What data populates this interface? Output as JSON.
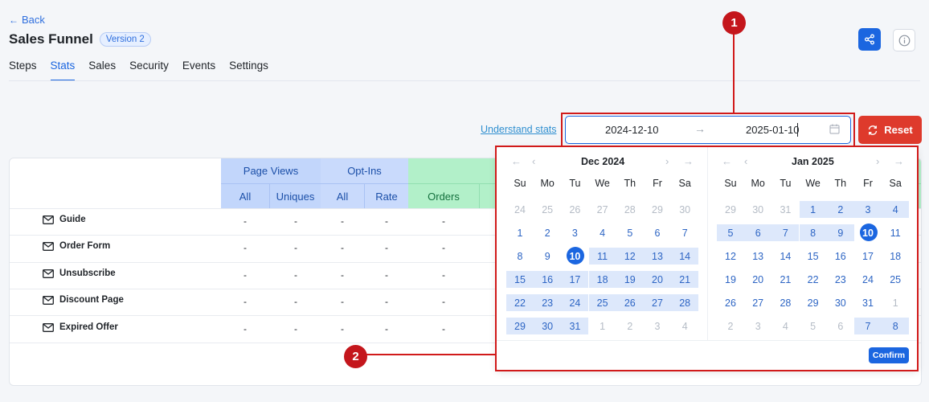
{
  "nav": {
    "back_label": "Back"
  },
  "header": {
    "title": "Sales Funnel",
    "version_badge": "Version 2"
  },
  "tabs": [
    {
      "label": "Steps",
      "active": false
    },
    {
      "label": "Stats",
      "active": true
    },
    {
      "label": "Sales",
      "active": false
    },
    {
      "label": "Security",
      "active": false
    },
    {
      "label": "Events",
      "active": false
    },
    {
      "label": "Settings",
      "active": false
    }
  ],
  "toolbar": {
    "understand_stats_link": "Understand stats",
    "start_date": "2024-12-10",
    "end_date": "2025-01-10",
    "reset_label": "Reset",
    "accent_color": "#1b66e0",
    "reset_color": "#de3a2c"
  },
  "annotations": {
    "marker1": "1",
    "marker2": "2"
  },
  "table": {
    "groups": [
      "Page Views",
      "Opt-Ins"
    ],
    "subcolumns": [
      "All",
      "Uniques",
      "All",
      "Rate",
      "Orders"
    ],
    "rows": [
      {
        "label": "Guide",
        "cells": [
          "-",
          "-",
          "-",
          "-",
          "-"
        ]
      },
      {
        "label": "Order Form",
        "cells": [
          "-",
          "-",
          "-",
          "-",
          "-"
        ]
      },
      {
        "label": "Unsubscribe",
        "cells": [
          "-",
          "-",
          "-",
          "-",
          "-"
        ]
      },
      {
        "label": "Discount Page",
        "cells": [
          "-",
          "-",
          "-",
          "-",
          "-"
        ]
      },
      {
        "label": "Expired Offer",
        "cells": [
          "-",
          "-",
          "-",
          "-",
          "-"
        ]
      }
    ]
  },
  "datepicker": {
    "weekdays": [
      "Su",
      "Mo",
      "Tu",
      "We",
      "Th",
      "Fr",
      "Sa"
    ],
    "left": {
      "month": "Dec 2024",
      "weeks": [
        [
          "24",
          "25",
          "26",
          "27",
          "28",
          "29",
          "30"
        ],
        [
          "1",
          "2",
          "3",
          "4",
          "5",
          "6",
          "7"
        ],
        [
          "8",
          "9",
          "10",
          "11",
          "12",
          "13",
          "14"
        ],
        [
          "15",
          "16",
          "17",
          "18",
          "19",
          "20",
          "21"
        ],
        [
          "22",
          "23",
          "24",
          "25",
          "26",
          "27",
          "28"
        ],
        [
          "29",
          "30",
          "31",
          "1",
          "2",
          "3",
          "4"
        ]
      ]
    },
    "right": {
      "month": "Jan 2025",
      "weeks": [
        [
          "29",
          "30",
          "31",
          "1",
          "2",
          "3",
          "4"
        ],
        [
          "5",
          "6",
          "7",
          "8",
          "9",
          "10",
          "11"
        ],
        [
          "12",
          "13",
          "14",
          "15",
          "16",
          "17",
          "18"
        ],
        [
          "19",
          "20",
          "21",
          "22",
          "23",
          "24",
          "25"
        ],
        [
          "26",
          "27",
          "28",
          "29",
          "30",
          "31",
          "1"
        ],
        [
          "2",
          "3",
          "4",
          "5",
          "6",
          "7",
          "8"
        ]
      ]
    },
    "confirm_label": "Confirm"
  }
}
